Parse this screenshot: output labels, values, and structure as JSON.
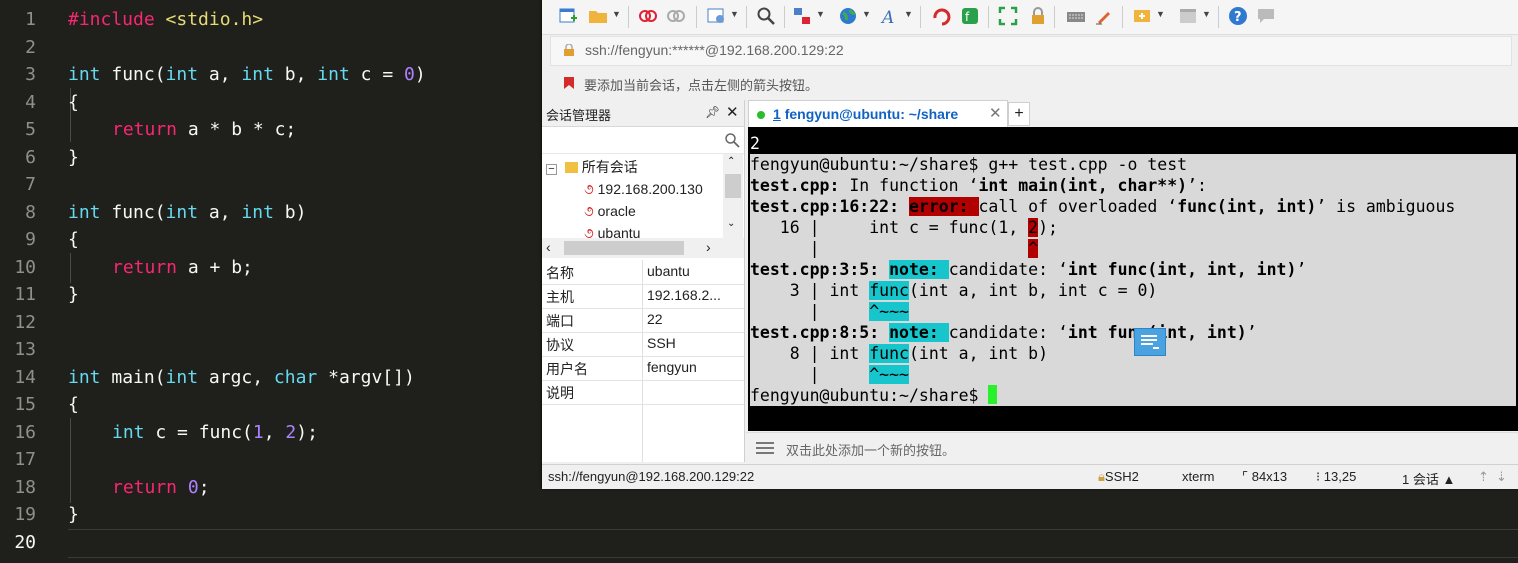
{
  "editor": {
    "current_line": "20",
    "lines": [
      {
        "n": "1"
      },
      {
        "n": "2"
      },
      {
        "n": "3"
      },
      {
        "n": "4"
      },
      {
        "n": "5"
      },
      {
        "n": "6"
      },
      {
        "n": "7"
      },
      {
        "n": "8"
      },
      {
        "n": "9"
      },
      {
        "n": "10"
      },
      {
        "n": "11"
      },
      {
        "n": "12"
      },
      {
        "n": "13"
      },
      {
        "n": "14"
      },
      {
        "n": "15"
      },
      {
        "n": "16"
      },
      {
        "n": "17"
      },
      {
        "n": "18"
      },
      {
        "n": "19"
      },
      {
        "n": "20"
      }
    ],
    "code": {
      "l1": {
        "include": "#include",
        "header": "<stdio.h>"
      },
      "l3": {
        "t1": "int",
        "f": " func(",
        "t2": "int",
        "a": " a, ",
        "t3": "int",
        "b": " b, ",
        "t4": "int",
        "c": " c = ",
        "z": "0",
        ")": ")"
      },
      "l4": "{",
      "l5": {
        "ret": "return",
        "expr": " a * b * c;"
      },
      "l6": "}",
      "l8": {
        "t1": "int",
        "f": " func(",
        "t2": "int",
        "a": " a, ",
        "t3": "int",
        "b": " b)"
      },
      "l9": "{",
      "l10": {
        "ret": "return",
        "expr": " a + b;"
      },
      "l11": "}",
      "l14": {
        "t1": "int",
        "f": " main(",
        "t2": "int",
        "a": " argc, ",
        "t3": "char",
        "b": " *argv[])"
      },
      "l15": "{",
      "l16": {
        "t1": "int",
        "expr": " c = func(",
        "one": "1",
        ",": ", ",
        "two": "2",
        "end": ");"
      },
      "l18": {
        "ret": "return",
        "sp": " ",
        "zero": "0",
        "end": ";"
      },
      "l19": "}"
    }
  },
  "xshell": {
    "address": "ssh://fengyun:******@192.168.200.129:22",
    "hint": "要添加当前会话，点击左侧的箭头按钮。",
    "session_manager": {
      "title": "会话管理器",
      "tree_root": "所有会话",
      "sessions": [
        "192.168.200.130",
        "oracle",
        "ubantu"
      ],
      "properties": [
        {
          "k": "名称",
          "v": "ubantu"
        },
        {
          "k": "主机",
          "v": "192.168.2..."
        },
        {
          "k": "端口",
          "v": "22"
        },
        {
          "k": "协议",
          "v": "SSH"
        },
        {
          "k": "用户名",
          "v": "fengyun"
        },
        {
          "k": "说明",
          "v": ""
        }
      ]
    },
    "tab": {
      "index": "1",
      "label": "fengyun@ubuntu: ~/share",
      "plus": "+"
    },
    "terminal": {
      "l0": "2",
      "l1": "fengyun@ubuntu:~/share$ g++ test.cpp -o test",
      "l2": {
        "file": "test.cpp:",
        "mid": " In function ‘",
        "sig": "int main(int, char**)",
        "end": "’:"
      },
      "l3": {
        "loc": "test.cpp:16:22: ",
        "err": "error: ",
        "msg": "call of overloaded ‘",
        "sig": "func(int, int)",
        "end": "’ is ambiguous"
      },
      "l4": {
        "pre": "   16 |     int c = func(1, ",
        "hl": "2",
        "post": ");"
      },
      "l5": {
        "pre": "      |                     ",
        "hl": "^"
      },
      "l6": {
        "loc": "test.cpp:3:5: ",
        "note": "note: ",
        "msg": "candidate: ‘",
        "sig": "int func(int, int, int)",
        "end": "’"
      },
      "l7": {
        "pre": "    3 | int ",
        "hl": "func",
        "post": "(int a, int b, int c = 0)"
      },
      "l8": {
        "pre": "      |     ",
        "hl": "^~~~"
      },
      "l9": {
        "loc": "test.cpp:8:5: ",
        "note": "note: ",
        "msg": "candidate: ‘",
        "sig": "int func(int, int)",
        "end": "’"
      },
      "l10": {
        "pre": "    8 | int ",
        "hl": "func",
        "post": "(int a, int b)"
      },
      "l11": {
        "pre": "      |     ",
        "hl": "^~~~"
      },
      "prompt": "fengyun@ubuntu:~/share$ "
    },
    "quickbar": "双击此处添加一个新的按钮。",
    "status": {
      "connection": "ssh://fengyun@192.168.200.129:22",
      "protocol": "SSH2",
      "term": "xterm",
      "size": "84x13",
      "cursor_pos": "13,25",
      "sessions": "1 会话"
    }
  }
}
